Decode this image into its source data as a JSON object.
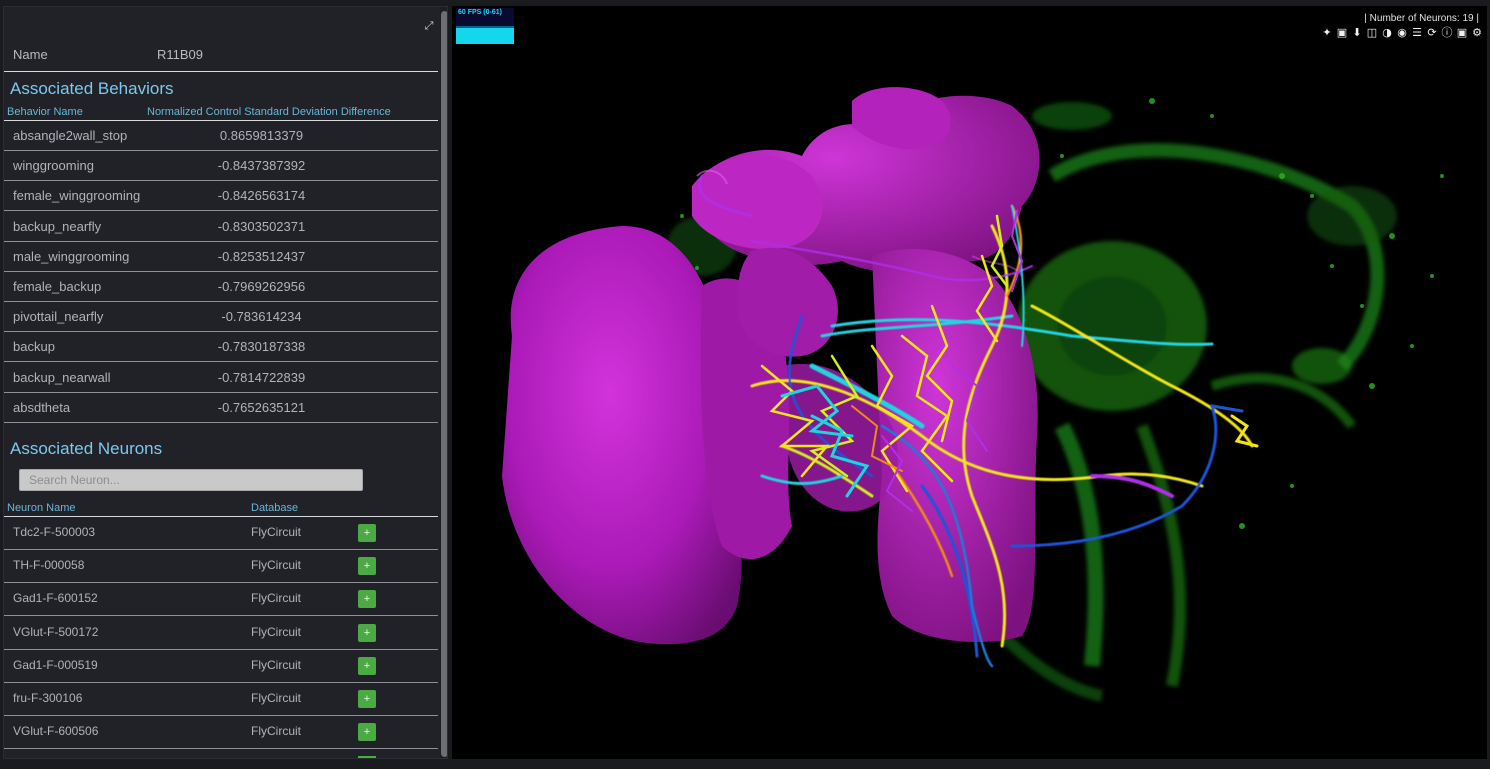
{
  "panel": {
    "name_label": "Name",
    "name_value": "R11B09",
    "behaviors_title": "Associated Behaviors",
    "behavior_columns": [
      "Behavior Name",
      "Normalized Control Standard Deviation Difference"
    ],
    "behaviors": [
      {
        "name": "absangle2wall_stop",
        "value": "0.8659813379"
      },
      {
        "name": "winggrooming",
        "value": "-0.8437387392"
      },
      {
        "name": "female_winggrooming",
        "value": "-0.8426563174"
      },
      {
        "name": "backup_nearfly",
        "value": "-0.8303502371"
      },
      {
        "name": "male_winggrooming",
        "value": "-0.8253512437"
      },
      {
        "name": "female_backup",
        "value": "-0.7969262956"
      },
      {
        "name": "pivottail_nearfly",
        "value": "-0.783614234"
      },
      {
        "name": "backup",
        "value": "-0.7830187338"
      },
      {
        "name": "backup_nearwall",
        "value": "-0.7814722839"
      },
      {
        "name": "absdtheta",
        "value": "-0.7652635121"
      }
    ],
    "neurons_title": "Associated Neurons",
    "search_placeholder": "Search Neuron...",
    "neuron_columns": [
      "Neuron Name",
      "Database"
    ],
    "neurons": [
      {
        "name": "Tdc2-F-500003",
        "database": "FlyCircuit"
      },
      {
        "name": "TH-F-000058",
        "database": "FlyCircuit"
      },
      {
        "name": "Gad1-F-600152",
        "database": "FlyCircuit"
      },
      {
        "name": "VGlut-F-500172",
        "database": "FlyCircuit"
      },
      {
        "name": "Gad1-F-000519",
        "database": "FlyCircuit"
      },
      {
        "name": "fru-F-300106",
        "database": "FlyCircuit"
      },
      {
        "name": "VGlut-F-600506",
        "database": "FlyCircuit"
      }
    ],
    "add_button_label": "+"
  },
  "viewer": {
    "fps_label": "60 FPS (0-61)",
    "neuron_count_label": "| Number of Neurons: 19 |",
    "toolbar_icons": [
      "magic-wand-icon",
      "cube-icon",
      "download-icon",
      "trash-icon",
      "eye-slash-icon",
      "eye-icon",
      "list-icon",
      "refresh-icon",
      "info-icon",
      "camera-icon",
      "gear-icon"
    ],
    "colors": {
      "neuropil": "#c81fd1",
      "background_stain": "#1fa31a",
      "neurons": [
        "#f2e51b",
        "#21d3de",
        "#1d55d8",
        "#f28a12",
        "#b12fe8",
        "#d4f01a"
      ]
    }
  }
}
